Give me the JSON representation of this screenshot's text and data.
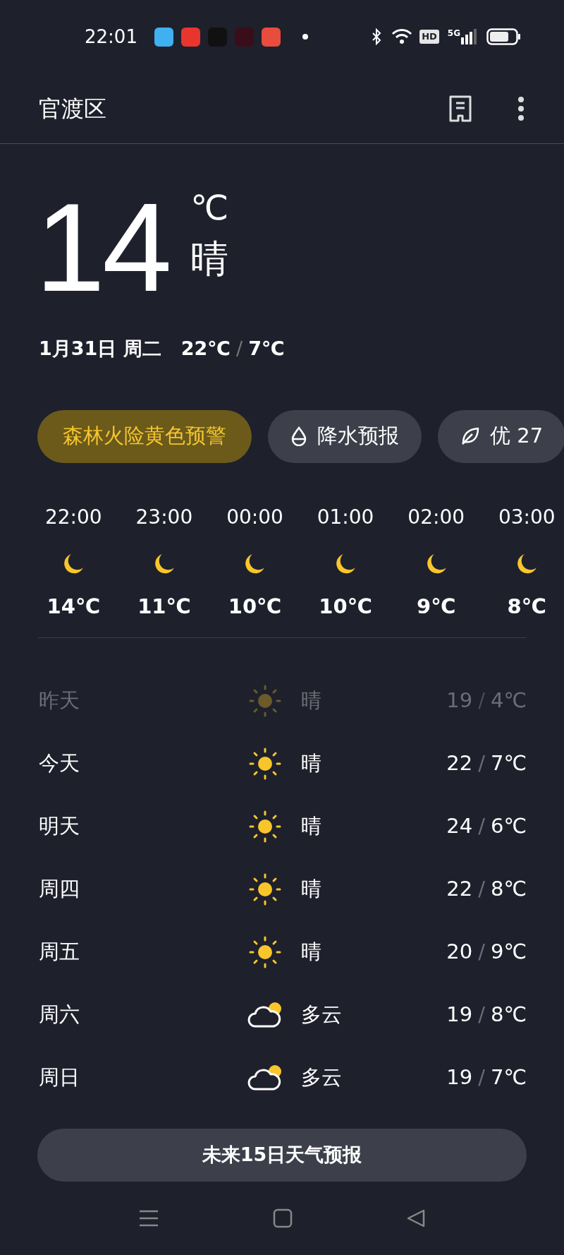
{
  "status_bar": {
    "time": "22:01",
    "hd": "HD",
    "network": "5G"
  },
  "header": {
    "title": "官渡区"
  },
  "current": {
    "temp": "14",
    "unit": "℃",
    "condition": "晴",
    "date": "1月31日 周二",
    "high": "22℃",
    "sep": "/",
    "low": "7℃"
  },
  "chips": [
    {
      "kind": "alert",
      "label": "森林火险黄色预警"
    },
    {
      "kind": "rain",
      "label": "降水预报"
    },
    {
      "kind": "air",
      "label": "优 27"
    }
  ],
  "hourly": [
    {
      "time": "22:00",
      "kind": "moon",
      "temp": "14℃"
    },
    {
      "time": "23:00",
      "kind": "moon",
      "temp": "11℃"
    },
    {
      "time": "00:00",
      "kind": "moon",
      "temp": "10℃"
    },
    {
      "time": "01:00",
      "kind": "moon",
      "temp": "10℃"
    },
    {
      "time": "02:00",
      "kind": "moon",
      "temp": "9℃"
    },
    {
      "time": "03:00",
      "kind": "moon",
      "temp": "8℃"
    }
  ],
  "daily": [
    {
      "day": "昨天",
      "kind": "sun",
      "condition": "晴",
      "high": "19",
      "sep": "/",
      "low": "4℃",
      "past": true
    },
    {
      "day": "今天",
      "kind": "sun",
      "condition": "晴",
      "high": "22",
      "sep": "/",
      "low": "7℃",
      "past": false
    },
    {
      "day": "明天",
      "kind": "sun",
      "condition": "晴",
      "high": "24",
      "sep": "/",
      "low": "6℃",
      "past": false
    },
    {
      "day": "周四",
      "kind": "sun",
      "condition": "晴",
      "high": "22",
      "sep": "/",
      "low": "8℃",
      "past": false
    },
    {
      "day": "周五",
      "kind": "sun",
      "condition": "晴",
      "high": "20",
      "sep": "/",
      "low": "9℃",
      "past": false
    },
    {
      "day": "周六",
      "kind": "cloud",
      "condition": "多云",
      "high": "19",
      "sep": "/",
      "low": "8℃",
      "past": false
    },
    {
      "day": "周日",
      "kind": "cloud",
      "condition": "多云",
      "high": "19",
      "sep": "/",
      "low": "7℃",
      "past": false
    }
  ],
  "forecast_button": {
    "label": "未来15日天气预报"
  }
}
